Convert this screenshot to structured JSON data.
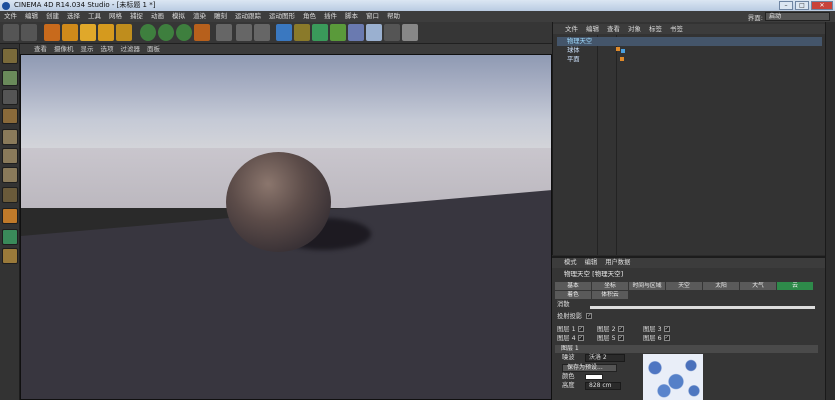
{
  "title": "CINEMA 4D R14.034 Studio - [未标题 1 *]",
  "window_buttons": {
    "minimize": "–",
    "maximize": "□",
    "close": "✕"
  },
  "menu": [
    "文件",
    "编辑",
    "创建",
    "选择",
    "工具",
    "网格",
    "捕捉",
    "动画",
    "模拟",
    "渲染",
    "雕刻",
    "运动跟踪",
    "运动图形",
    "角色",
    "插件",
    "脚本",
    "窗口",
    "帮助"
  ],
  "layout": {
    "label": "界面:",
    "value": "启动"
  },
  "viewport_menu": [
    "查看",
    "摄像机",
    "显示",
    "选项",
    "过滤器",
    "面板"
  ],
  "object_manager": {
    "tabs": [
      "文件",
      "编辑",
      "查看",
      "对象",
      "标签",
      "书签"
    ],
    "objects": [
      {
        "name": "物理天空",
        "selected": true
      },
      {
        "name": "球体",
        "selected": false
      },
      {
        "name": "平面",
        "selected": false
      }
    ]
  },
  "attributes": {
    "menu": [
      "模式",
      "编辑",
      "用户数据"
    ],
    "title": "物理天空 [物理天空]",
    "tabs_row1": [
      "基本",
      "坐标",
      "时间与区域",
      "天空",
      "太阳",
      "大气",
      "云"
    ],
    "tabs_row2": [
      "着色",
      "体积云"
    ],
    "active_tab": "云",
    "props": {
      "disperse": "消散",
      "cast_shadow": "投射投影",
      "cast_shadow_check": "✓"
    },
    "layers": [
      {
        "label": "图层 1",
        "check": "✓"
      },
      {
        "label": "图层 2",
        "check": "✓"
      },
      {
        "label": "图层 3",
        "check": "✓"
      },
      {
        "label": "图层 4",
        "check": "✓"
      },
      {
        "label": "图层 5",
        "check": "✓"
      },
      {
        "label": "图层 6",
        "check": "✓"
      }
    ],
    "section": "图层 1",
    "noise_label": "噪波",
    "noise_value": "沃洛 2",
    "save_preset": "保存为预设...",
    "color_label": "颜色",
    "height_label": "高度",
    "height_value": "828 cm"
  },
  "colors": {
    "active_tab": "#2e8a4a",
    "selection": "#44556a"
  }
}
